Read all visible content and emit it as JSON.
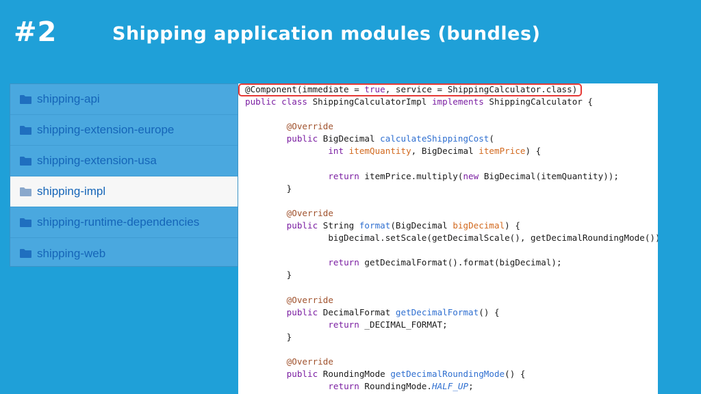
{
  "slide": {
    "number": "#2",
    "title": "Shipping application modules (bundles)"
  },
  "modules": {
    "items": [
      {
        "label": "shipping-api",
        "active": false
      },
      {
        "label": "shipping-extension-europe",
        "active": false
      },
      {
        "label": "shipping-extension-usa",
        "active": false
      },
      {
        "label": "shipping-impl",
        "active": true
      },
      {
        "label": "shipping-runtime-dependencies",
        "active": false
      },
      {
        "label": "shipping-web",
        "active": false
      }
    ],
    "icon": "folder-icon"
  },
  "code": {
    "highlight_color": "#e53935",
    "lines": [
      [
        {
          "t": "@Component(immediate = ",
          "c": ""
        },
        {
          "t": "true",
          "c": "kw"
        },
        {
          "t": ", service = ShippingCalculator.class)",
          "c": ""
        }
      ],
      [
        {
          "t": "public class ",
          "c": "kw"
        },
        {
          "t": "ShippingCalculatorImpl ",
          "c": ""
        },
        {
          "t": "implements ",
          "c": "kw"
        },
        {
          "t": "ShippingCalculator {",
          "c": ""
        }
      ],
      [
        {
          "t": "",
          "c": ""
        }
      ],
      [
        {
          "t": "        ",
          "c": ""
        },
        {
          "t": "@Override",
          "c": "ann"
        }
      ],
      [
        {
          "t": "        ",
          "c": ""
        },
        {
          "t": "public ",
          "c": "kw"
        },
        {
          "t": "BigDecimal ",
          "c": ""
        },
        {
          "t": "calculateShippingCost",
          "c": "fn"
        },
        {
          "t": "(",
          "c": ""
        }
      ],
      [
        {
          "t": "                ",
          "c": ""
        },
        {
          "t": "int ",
          "c": "kw"
        },
        {
          "t": "itemQuantity",
          "c": "param"
        },
        {
          "t": ", BigDecimal ",
          "c": ""
        },
        {
          "t": "itemPrice",
          "c": "param"
        },
        {
          "t": ") {",
          "c": ""
        }
      ],
      [
        {
          "t": "",
          "c": ""
        }
      ],
      [
        {
          "t": "                ",
          "c": ""
        },
        {
          "t": "return ",
          "c": "kw"
        },
        {
          "t": "itemPrice.multiply(",
          "c": ""
        },
        {
          "t": "new ",
          "c": "kw"
        },
        {
          "t": "BigDecimal(itemQuantity));",
          "c": ""
        }
      ],
      [
        {
          "t": "        }",
          "c": ""
        }
      ],
      [
        {
          "t": "",
          "c": ""
        }
      ],
      [
        {
          "t": "        ",
          "c": ""
        },
        {
          "t": "@Override",
          "c": "ann"
        }
      ],
      [
        {
          "t": "        ",
          "c": ""
        },
        {
          "t": "public ",
          "c": "kw"
        },
        {
          "t": "String ",
          "c": ""
        },
        {
          "t": "format",
          "c": "fn"
        },
        {
          "t": "(BigDecimal ",
          "c": ""
        },
        {
          "t": "bigDecimal",
          "c": "param"
        },
        {
          "t": ") {",
          "c": ""
        }
      ],
      [
        {
          "t": "                bigDecimal.setScale(getDecimalScale(), getDecimalRoundingMode());",
          "c": ""
        }
      ],
      [
        {
          "t": "",
          "c": ""
        }
      ],
      [
        {
          "t": "                ",
          "c": ""
        },
        {
          "t": "return ",
          "c": "kw"
        },
        {
          "t": "getDecimalFormat().format(bigDecimal);",
          "c": ""
        }
      ],
      [
        {
          "t": "        }",
          "c": ""
        }
      ],
      [
        {
          "t": "",
          "c": ""
        }
      ],
      [
        {
          "t": "        ",
          "c": ""
        },
        {
          "t": "@Override",
          "c": "ann"
        }
      ],
      [
        {
          "t": "        ",
          "c": ""
        },
        {
          "t": "public ",
          "c": "kw"
        },
        {
          "t": "DecimalFormat ",
          "c": ""
        },
        {
          "t": "getDecimalFormat",
          "c": "fn"
        },
        {
          "t": "() {",
          "c": ""
        }
      ],
      [
        {
          "t": "                ",
          "c": ""
        },
        {
          "t": "return ",
          "c": "kw"
        },
        {
          "t": "_DECIMAL_FORMAT;",
          "c": ""
        }
      ],
      [
        {
          "t": "        }",
          "c": ""
        }
      ],
      [
        {
          "t": "",
          "c": ""
        }
      ],
      [
        {
          "t": "        ",
          "c": ""
        },
        {
          "t": "@Override",
          "c": "ann"
        }
      ],
      [
        {
          "t": "        ",
          "c": ""
        },
        {
          "t": "public ",
          "c": "kw"
        },
        {
          "t": "RoundingMode ",
          "c": ""
        },
        {
          "t": "getDecimalRoundingMode",
          "c": "fn"
        },
        {
          "t": "() {",
          "c": ""
        }
      ],
      [
        {
          "t": "                ",
          "c": ""
        },
        {
          "t": "return ",
          "c": "kw"
        },
        {
          "t": "RoundingMode.",
          "c": ""
        },
        {
          "t": "HALF_UP",
          "c": "field"
        },
        {
          "t": ";",
          "c": ""
        }
      ]
    ]
  }
}
